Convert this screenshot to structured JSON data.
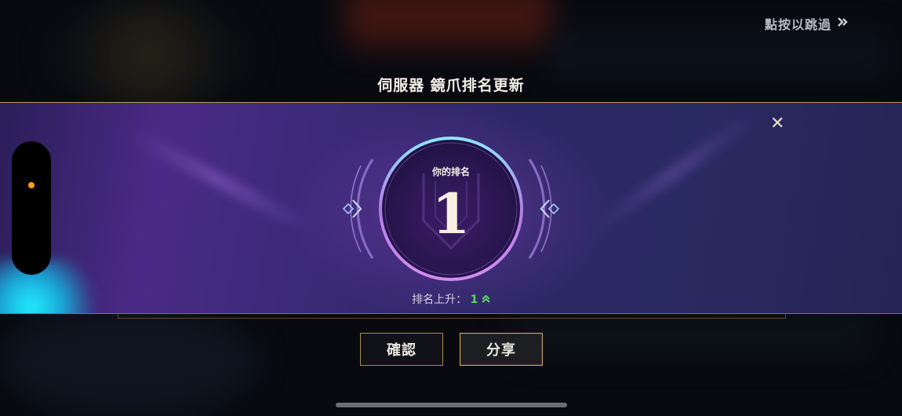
{
  "skip": {
    "label": "點按以跳過",
    "icon": "skip-arrow-icon"
  },
  "title": "伺服器 鏡爪排名更新",
  "rank_card": {
    "label": "你的排名",
    "value": "1",
    "change_label": "排名上升：",
    "change_value": "1",
    "change_icon": "double-chevron-up-icon"
  },
  "buttons": {
    "confirm": "確認",
    "share": "分享"
  },
  "colors": {
    "accent_gold": "#b89a5e",
    "rise_green": "#5fd36b",
    "banner_purple": "#4a2a86"
  }
}
